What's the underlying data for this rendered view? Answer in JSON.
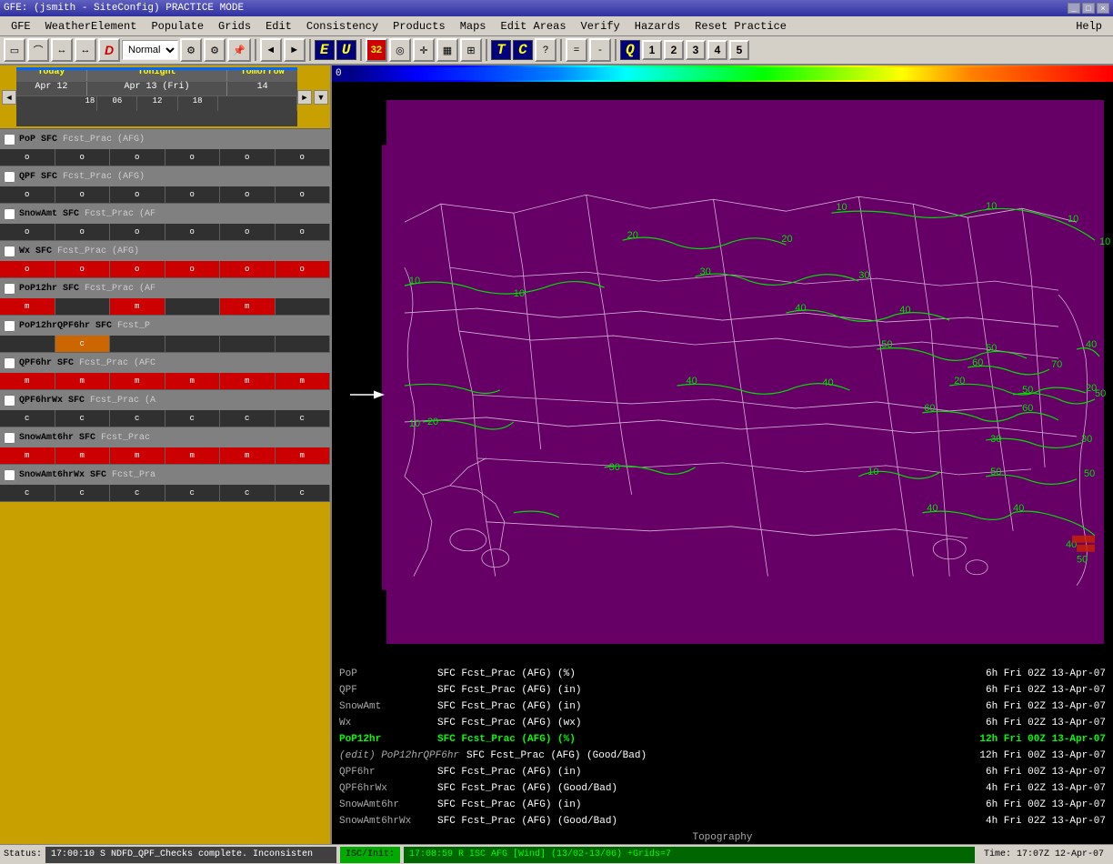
{
  "titlebar": {
    "title": "GFE: (jsmith - SiteConfig)  PRACTICE MODE",
    "buttons": [
      "_",
      "□",
      "×"
    ]
  },
  "menubar": {
    "items": [
      "GFE",
      "WeatherElement",
      "Populate",
      "Grids",
      "Edit",
      "Consistency",
      "Products",
      "Maps",
      "Edit Areas",
      "Verify",
      "Hazards",
      "Reset Practice",
      "Help"
    ]
  },
  "toolbar": {
    "mode_label": "Normal",
    "nav_prev": "◄",
    "nav_next": "►",
    "bold_d": "D",
    "zoom_level": "32",
    "number_buttons": [
      "1",
      "2",
      "3",
      "4",
      "5"
    ],
    "eq_btn": "=",
    "minus_btn": "-",
    "q_btn": "Q"
  },
  "timeline": {
    "today_label": "Today",
    "tonight_label": "Tonight",
    "tomorrow_label": "Tomorrow",
    "date1": "Apr 12",
    "date2": "Apr 13 (Fri)",
    "date3": "14",
    "hours1": [
      "18"
    ],
    "hours2": [
      "06",
      "12",
      "18"
    ],
    "hours3": []
  },
  "grid_rows": [
    {
      "id": "pop-sfc",
      "label": "PoP SFC",
      "sublabel": "Fcst_Prac (AFG)",
      "cells": [
        {
          "val": "o",
          "style": "dark"
        },
        {
          "val": "o",
          "style": "dark"
        },
        {
          "val": "o",
          "style": "dark"
        },
        {
          "val": "o",
          "style": "dark"
        },
        {
          "val": "o",
          "style": "dark"
        },
        {
          "val": "o",
          "style": "dark"
        }
      ]
    },
    {
      "id": "qpf-sfc",
      "label": "QPF SFC",
      "sublabel": "Fcst_Prac (AFG)",
      "cells": [
        {
          "val": "o",
          "style": "dark"
        },
        {
          "val": "o",
          "style": "dark"
        },
        {
          "val": "o",
          "style": "dark"
        },
        {
          "val": "o",
          "style": "dark"
        },
        {
          "val": "o",
          "style": "dark"
        },
        {
          "val": "o",
          "style": "dark"
        }
      ]
    },
    {
      "id": "snowamt-sfc",
      "label": "SnowAmt SFC",
      "sublabel": "Fcst_Prac (AF",
      "cells": [
        {
          "val": "o",
          "style": "dark"
        },
        {
          "val": "o",
          "style": "dark"
        },
        {
          "val": "o",
          "style": "dark"
        },
        {
          "val": "o",
          "style": "dark"
        },
        {
          "val": "o",
          "style": "dark"
        },
        {
          "val": "o",
          "style": "dark"
        }
      ]
    },
    {
      "id": "wx-sfc",
      "label": "Wx SFC",
      "sublabel": "Fcst_Prac (AFG)",
      "cells": [
        {
          "val": "o",
          "style": "red"
        },
        {
          "val": "o",
          "style": "red"
        },
        {
          "val": "o",
          "style": "red"
        },
        {
          "val": "o",
          "style": "red"
        },
        {
          "val": "o",
          "style": "red"
        },
        {
          "val": "o",
          "style": "red"
        }
      ]
    },
    {
      "id": "pop12hr-sfc",
      "label": "PoP12hr SFC",
      "sublabel": "Fcst_Prac (AF",
      "cells": [
        {
          "val": "m",
          "style": "red"
        },
        {
          "val": "",
          "style": "dark"
        },
        {
          "val": "m",
          "style": "red"
        },
        {
          "val": "",
          "style": "dark"
        },
        {
          "val": "m",
          "style": "red"
        },
        {
          "val": "",
          "style": "dark"
        }
      ]
    },
    {
      "id": "pop12hr-qpf6hr",
      "label": "PoP12hrQPF6hr SFC",
      "sublabel": "Fcst_P",
      "cells": [
        {
          "val": "",
          "style": "dark"
        },
        {
          "val": "c",
          "style": "orange"
        },
        {
          "val": "",
          "style": "dark"
        },
        {
          "val": "",
          "style": "dark"
        },
        {
          "val": "",
          "style": "dark"
        },
        {
          "val": "",
          "style": "dark"
        }
      ]
    },
    {
      "id": "qpf6hr-sfc",
      "label": "QPF6hr SFC",
      "sublabel": "Fcst_Prac (AFC",
      "cells": [
        {
          "val": "m",
          "style": "red"
        },
        {
          "val": "m",
          "style": "red"
        },
        {
          "val": "m",
          "style": "red"
        },
        {
          "val": "m",
          "style": "red"
        },
        {
          "val": "m",
          "style": "red"
        },
        {
          "val": "m",
          "style": "red"
        }
      ]
    },
    {
      "id": "qpf6hrwx-sfc",
      "label": "QPF6hrWx SFC",
      "sublabel": "Fcst_Prac (A",
      "cells": [
        {
          "val": "c",
          "style": "dark"
        },
        {
          "val": "c",
          "style": "dark"
        },
        {
          "val": "c",
          "style": "dark"
        },
        {
          "val": "c",
          "style": "dark"
        },
        {
          "val": "c",
          "style": "dark"
        },
        {
          "val": "c",
          "style": "dark"
        }
      ]
    },
    {
      "id": "snowamt6hr-sfc",
      "label": "SnowAmt6hr SFC",
      "sublabel": "Fcst_Prac",
      "cells": [
        {
          "val": "m",
          "style": "red"
        },
        {
          "val": "m",
          "style": "red"
        },
        {
          "val": "m",
          "style": "red"
        },
        {
          "val": "m",
          "style": "red"
        },
        {
          "val": "m",
          "style": "red"
        },
        {
          "val": "m",
          "style": "red"
        }
      ]
    },
    {
      "id": "snowamt6hrwx-sfc",
      "label": "SnowAmt6hrWx SFC",
      "sublabel": "Fcst_Pra",
      "cells": [
        {
          "val": "c",
          "style": "dark"
        },
        {
          "val": "c",
          "style": "dark"
        },
        {
          "val": "c",
          "style": "dark"
        },
        {
          "val": "c",
          "style": "dark"
        },
        {
          "val": "c",
          "style": "dark"
        },
        {
          "val": "c",
          "style": "dark"
        }
      ]
    }
  ],
  "color_scale": {
    "label": "0"
  },
  "status_info": {
    "rows": [
      {
        "label": "PoP",
        "value": "SFC Fcst_Prac (AFG) (%)  ",
        "extra": "6h  Fri 02Z  13-Apr-07"
      },
      {
        "label": "QPF",
        "value": "SFC Fcst_Prac (AFG) (in) ",
        "extra": "6h  Fri 02Z  13-Apr-07"
      },
      {
        "label": "SnowAmt",
        "value": "SFC Fcst_Prac (AFG) (in) ",
        "extra": "6h  Fri 02Z  13-Apr-07"
      },
      {
        "label": "Wx",
        "value": "SFC Fcst_Prac (AFG) (wx) ",
        "extra": "6h  Fri 02Z  13-Apr-07"
      },
      {
        "label": "PoP12hr",
        "value": "SFC Fcst_Prac (AFG) (%)",
        "extra": "12h Fri 00Z  13-Apr-07",
        "highlight": true
      },
      {
        "label": "(edit) PoP12hrQPF6hr",
        "value": "SFC Fcst_Prac (AFG) (Good/Bad)",
        "extra": "12h Fri 00Z  13-Apr-07"
      },
      {
        "label": "QPF6hr",
        "value": "SFC Fcst_Prac (AFG) (in) ",
        "extra": "6h  Fri 00Z  13-Apr-07"
      },
      {
        "label": "QPF6hrWx",
        "value": "SFC Fcst_Prac (AFG) (Good/Bad)",
        "extra": "4h  Fri 02Z  13-Apr-07"
      },
      {
        "label": "SnowAmt6hr",
        "value": "SFC Fcst_Prac (AFG) (in) ",
        "extra": "6h  Fri 00Z  13-Apr-07"
      },
      {
        "label": "SnowAmt6hrWx",
        "value": "SFC Fcst_Prac (AFG) (Good/Bad)",
        "extra": "4h  Fri 02Z  13-Apr-07"
      },
      {
        "label": "Topography",
        "value": "",
        "extra": ""
      }
    ]
  },
  "statusbar": {
    "status_text": "17:00:10 S NDFD_QPF_Checks complete. Inconsisten",
    "isc_label": "ISC/Init:",
    "isc_data": "17:08:59 R ISC AFG [Wind] (13/02-13/06) +Grids=7",
    "time_text": "Time:  17:07Z 12-Apr-07"
  },
  "colors": {
    "accent_orange": "#c8a000",
    "menu_bg": "#d4d0c8",
    "title_bg": "#3030a0",
    "map_bg": "#660066",
    "contour_green": "#00cc00",
    "cell_red": "#cc0000",
    "highlight_green": "#00ff00"
  }
}
